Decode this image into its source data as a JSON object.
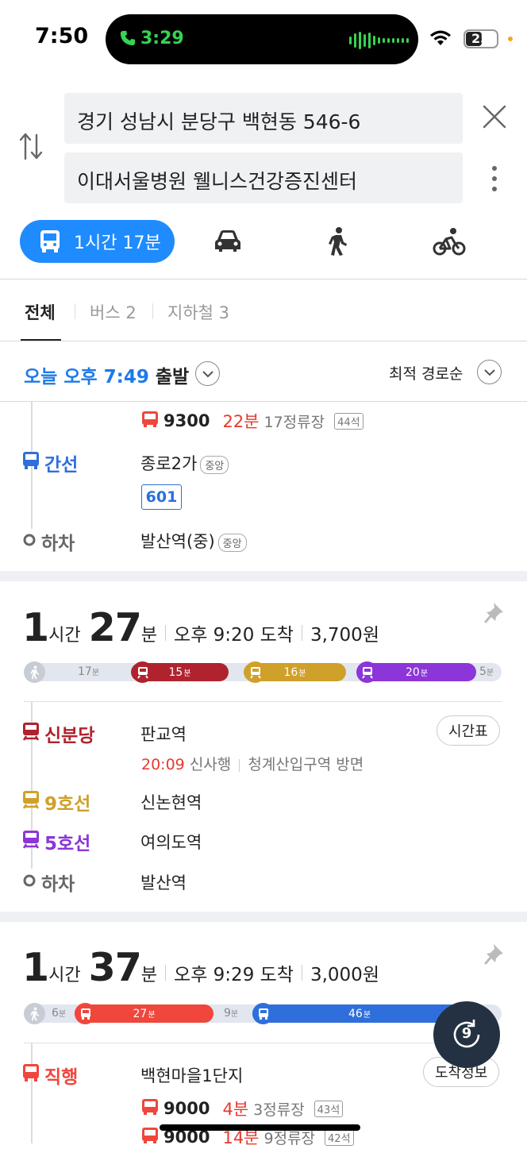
{
  "status": {
    "time": "7:50",
    "call_time": "3:29",
    "battery": "25"
  },
  "route_input": {
    "origin": "경기 성남시 분당구 백현동 546-6",
    "destination": "이대서울병원 웰니스건강증진센터"
  },
  "modes": {
    "transit_label": "1시간 17분",
    "icons": [
      "bus-icon",
      "car-icon",
      "walk-icon",
      "bike-icon"
    ]
  },
  "tabs": [
    {
      "label": "전체"
    },
    {
      "label": "버스 2"
    },
    {
      "label": "지하철 3"
    }
  ],
  "departure": {
    "text": "오늘 오후 7:49",
    "suffix": "출발",
    "sort": "최적 경로순"
  },
  "route0": {
    "bus_num": "9300",
    "bus_min": "22분",
    "bus_stops": "17정류장",
    "bus_seats": "44석",
    "leg_label": "간선",
    "leg_stop": "종로2가",
    "leg_tag": "중앙",
    "leg_bus": "601",
    "alight_label": "하차",
    "alight_stop": "발산역(중)",
    "alight_tag": "중앙"
  },
  "route1": {
    "hours": "1",
    "h_unit": "시간",
    "mins": "27",
    "m_unit": "분",
    "arrive": "오후 9:20 도착",
    "fare": "3,700원",
    "segments": [
      {
        "label": "17",
        "unit": "분",
        "color": "#e2e6ee"
      },
      {
        "label": "15",
        "unit": "분",
        "color": "#b0232e"
      },
      {
        "label": "16",
        "unit": "분",
        "color": "#cfa02a"
      },
      {
        "label": "20",
        "unit": "분",
        "color": "#8c35d8"
      },
      {
        "label": "5",
        "unit": "분",
        "color": "#e2e6ee"
      }
    ],
    "legs": [
      {
        "line": "신분당",
        "station": "판교역",
        "color": "#b0232e"
      },
      {
        "line": "9호선",
        "station": "신논현역",
        "color": "#cfa02a"
      },
      {
        "line": "5호선",
        "station": "여의도역",
        "color": "#8c35d8"
      },
      {
        "line": "하차",
        "station": "발산역",
        "color": "#666"
      }
    ],
    "timetable": "시간표",
    "next_time": "20:09",
    "direction1": "신사행",
    "direction2": "청계산입구역 방면"
  },
  "route2": {
    "hours": "1",
    "h_unit": "시간",
    "mins": "37",
    "m_unit": "분",
    "arrive": "오후 9:29 도착",
    "fare": "3,000원",
    "segments": [
      {
        "label": "6",
        "unit": "분"
      },
      {
        "label": "27",
        "unit": "분"
      },
      {
        "label": "9",
        "unit": "분"
      },
      {
        "label": "46",
        "unit": "분"
      }
    ],
    "leg_label": "직행",
    "leg_stop": "백현마을1단지",
    "arrival_info": "도착정보",
    "buses": [
      {
        "num": "9000",
        "min": "4분",
        "stops": "3정류장",
        "seats": "43석"
      },
      {
        "num": "9000",
        "min": "14분",
        "stops": "9정류장",
        "seats": "42석"
      }
    ]
  },
  "fab": {
    "label": "9"
  },
  "colors": {
    "accent": "#1e8bff",
    "bus_red": "#f0463c",
    "bus_blue": "#2f6fdc"
  }
}
